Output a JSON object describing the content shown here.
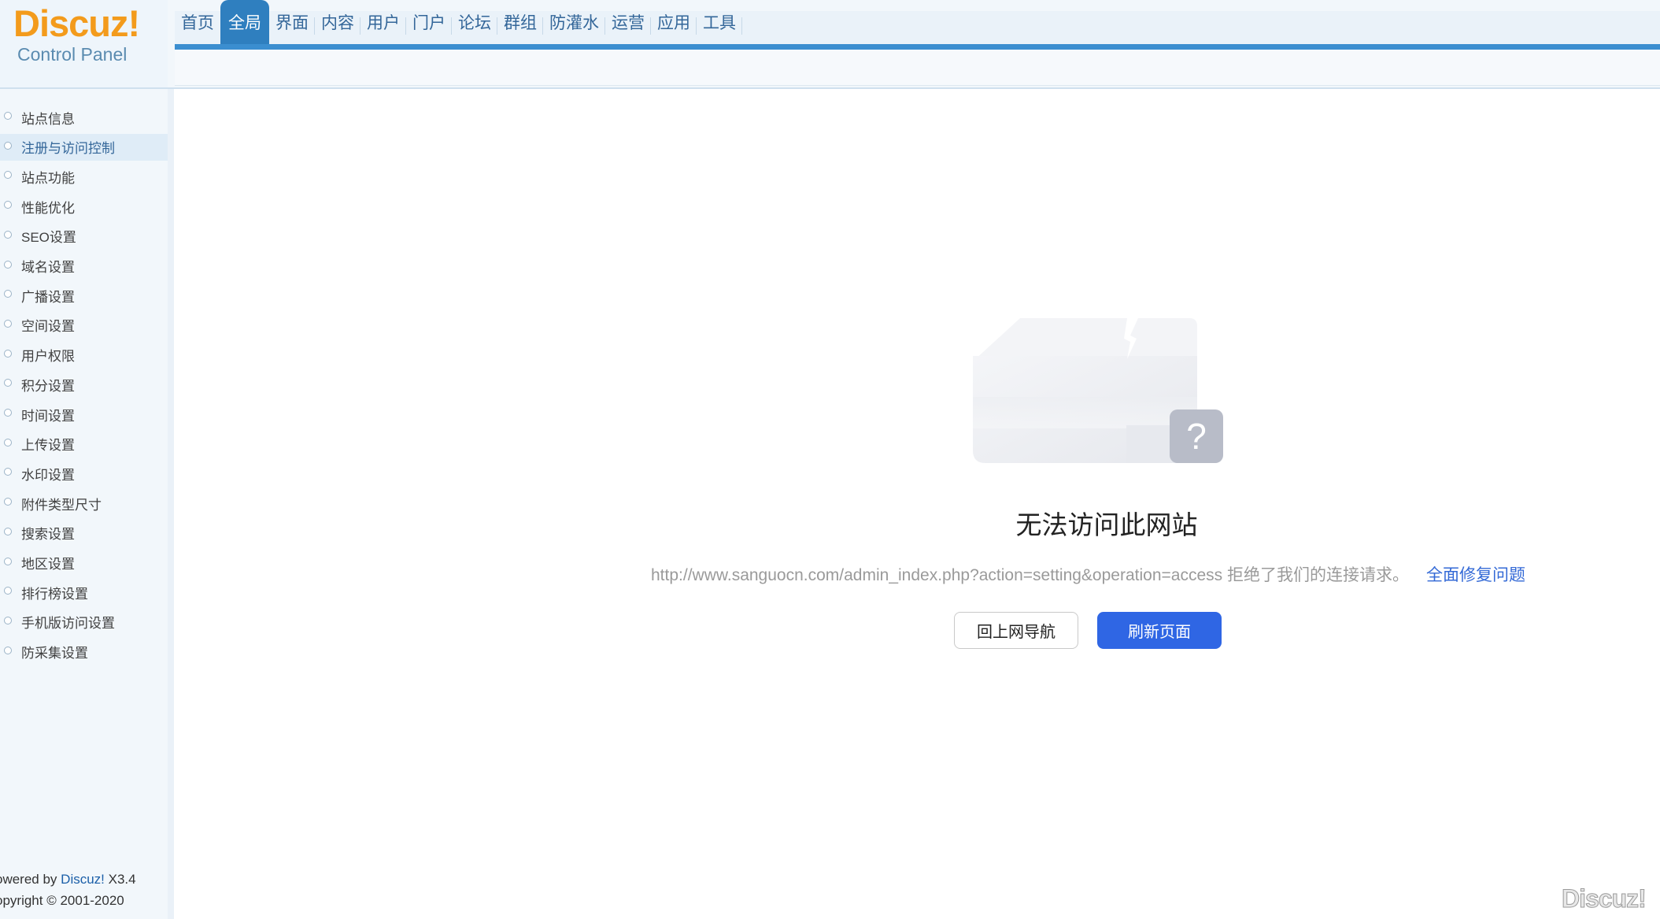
{
  "logo": {
    "brand": "Discuz!",
    "subtitle": "Control Panel"
  },
  "nav": {
    "items": [
      {
        "label": "首页",
        "active": false
      },
      {
        "label": "全局",
        "active": true
      },
      {
        "label": "界面",
        "active": false
      },
      {
        "label": "内容",
        "active": false
      },
      {
        "label": "用户",
        "active": false
      },
      {
        "label": "门户",
        "active": false
      },
      {
        "label": "论坛",
        "active": false
      },
      {
        "label": "群组",
        "active": false
      },
      {
        "label": "防灌水",
        "active": false
      },
      {
        "label": "运营",
        "active": false
      },
      {
        "label": "应用",
        "active": false
      },
      {
        "label": "工具",
        "active": false
      }
    ]
  },
  "sidebar": {
    "items": [
      {
        "label": "站点信息",
        "active": false
      },
      {
        "label": "注册与访问控制",
        "active": true
      },
      {
        "label": "站点功能",
        "active": false
      },
      {
        "label": "性能优化",
        "active": false
      },
      {
        "label": "SEO设置",
        "active": false
      },
      {
        "label": "域名设置",
        "active": false
      },
      {
        "label": "广播设置",
        "active": false
      },
      {
        "label": "空间设置",
        "active": false
      },
      {
        "label": "用户权限",
        "active": false
      },
      {
        "label": "积分设置",
        "active": false
      },
      {
        "label": "时间设置",
        "active": false
      },
      {
        "label": "上传设置",
        "active": false
      },
      {
        "label": "水印设置",
        "active": false
      },
      {
        "label": "附件类型尺寸",
        "active": false
      },
      {
        "label": "搜索设置",
        "active": false
      },
      {
        "label": "地区设置",
        "active": false
      },
      {
        "label": "排行榜设置",
        "active": false
      },
      {
        "label": "手机版访问设置",
        "active": false
      },
      {
        "label": "防采集设置",
        "active": false
      }
    ],
    "footer": {
      "powered_prefix": "owered by ",
      "powered_brand": "Discuz!",
      "powered_version": " X3.4",
      "copyright": "opyright © 2001-2020"
    }
  },
  "error": {
    "title": "无法访问此网站",
    "description": "http://www.sanguocn.com/admin_index.php?action=setting&operation=access 拒绝了我们的连接请求。",
    "fix_link": "全面修复问题",
    "back_button": "回上网导航",
    "refresh_button": "刷新页面"
  },
  "watermark": "Discuz!",
  "colors": {
    "accent": "#3b8ed0",
    "nav_active": "#2f7fbf",
    "logo_orange": "#f39b1c",
    "primary_button": "#2f66e4",
    "link": "#3369d6"
  }
}
